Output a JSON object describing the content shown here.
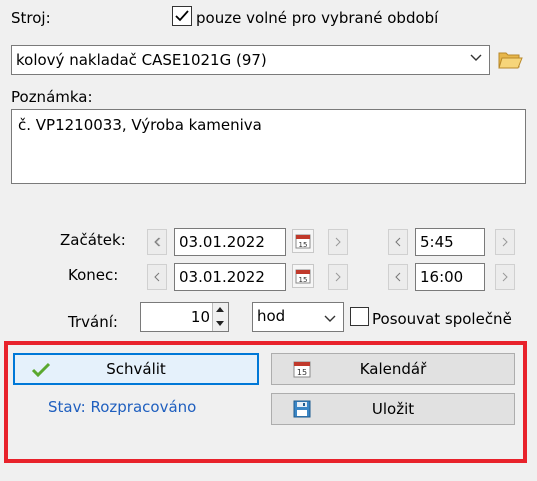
{
  "form": {
    "stroj_label": "Stroj:",
    "checkbox_free_label": "pouze volné pro vybrané období",
    "checkbox_free_checked": true,
    "machine_value": "kolový nakladač CASE1021G (97)",
    "note_label": "Poznámka:",
    "note_value": "č. VP1210033, Výroba kameniva",
    "start_label": "Začátek:",
    "start_date": "03.01.2022",
    "start_time": "5:45",
    "end_label": "Konec:",
    "end_date": "03.01.2022",
    "end_time": "16:00",
    "duration_label": "Trvání:",
    "duration_value": "10",
    "duration_unit": "hod",
    "shift_label": "Posouvat společně",
    "shift_checked": false,
    "calendar_day": "15"
  },
  "actions": {
    "approve_label": "Schválit",
    "status_text": "Stav: Rozpracováno",
    "calendar_label": "Kalendář",
    "save_label": "Uložit"
  },
  "colors": {
    "highlight_border": "#e8222b",
    "status_text": "#1f5fbf",
    "approve_border": "#0078d7",
    "check_green": "#5aa82e"
  },
  "icons": {
    "folder": "folder-open-icon",
    "calendar": "calendar-icon",
    "save": "floppy-disk-icon",
    "approve": "checkmark-icon"
  }
}
